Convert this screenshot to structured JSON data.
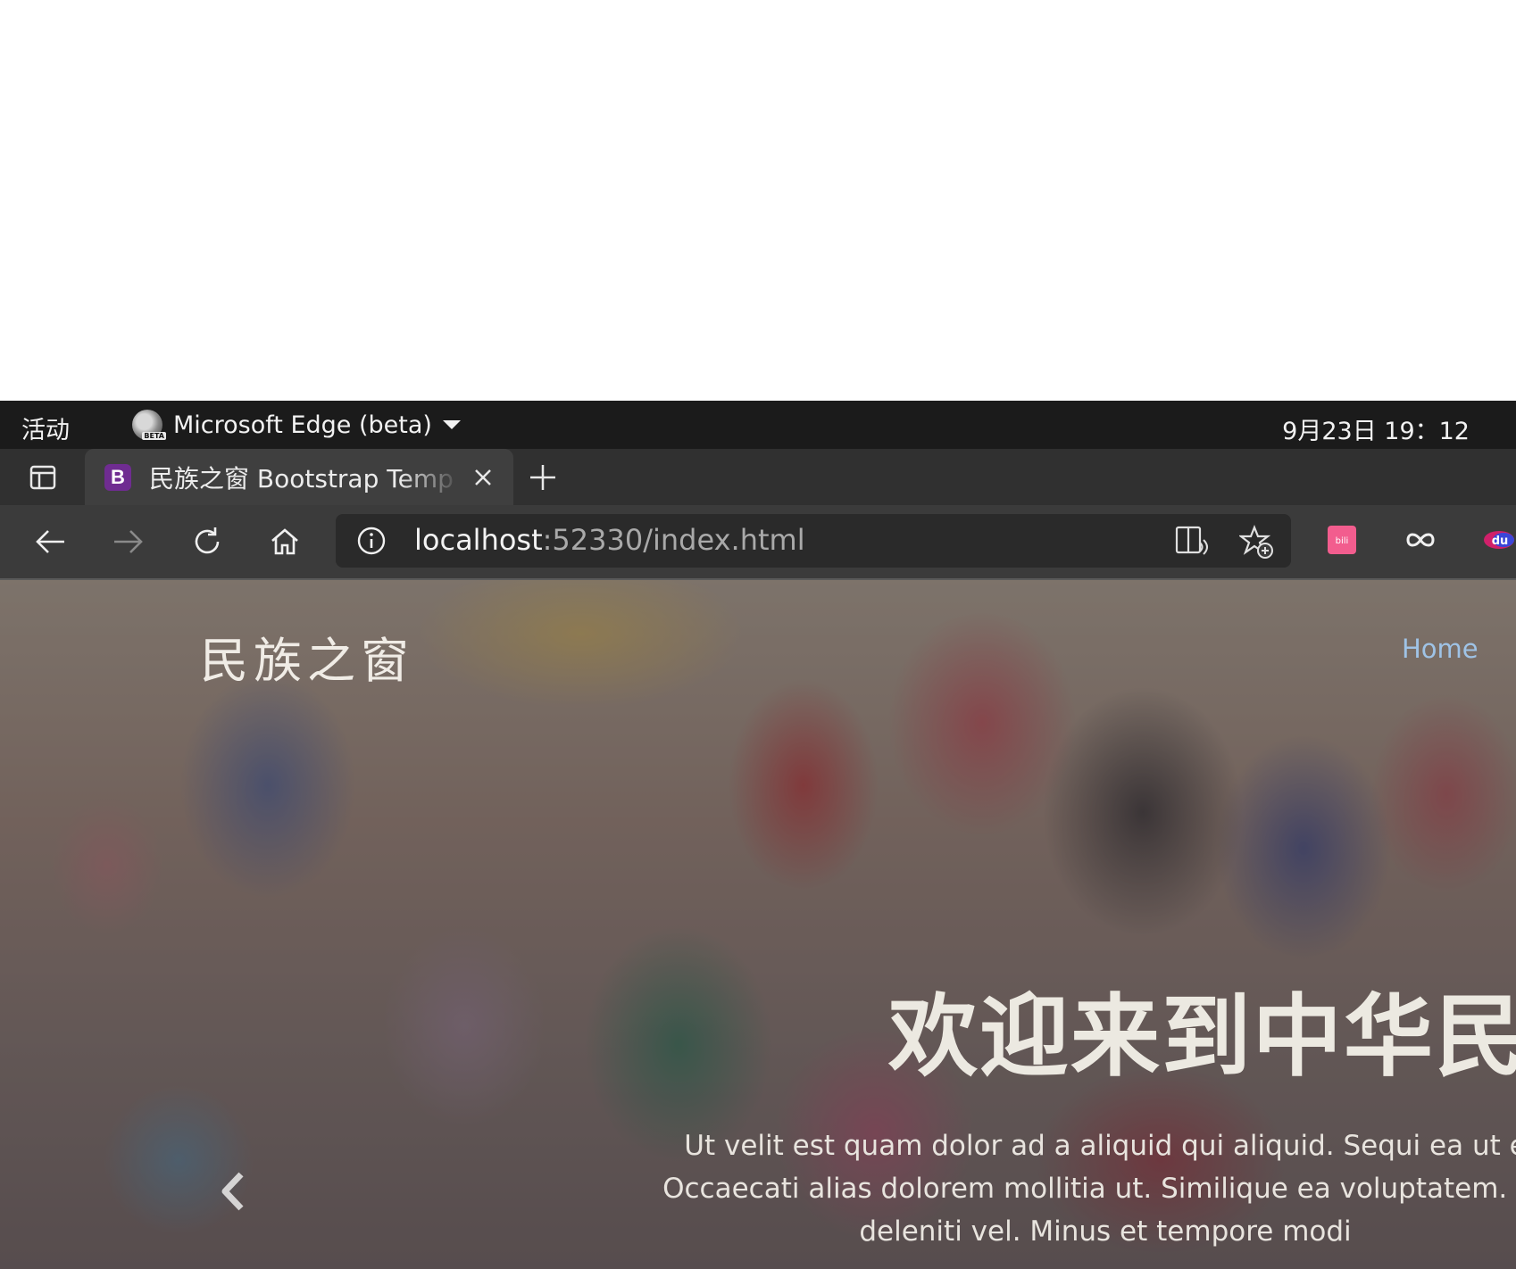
{
  "system_bar": {
    "activities": "活动",
    "app_name": "Microsoft Edge (beta)",
    "app_badge": "BETA",
    "clock": "9月23日  19：12"
  },
  "browser": {
    "tab": {
      "favicon_letter": "B",
      "title": "民族之窗 Bootstrap Temp"
    },
    "address": {
      "host": "localhost",
      "rest": ":52330/index.html"
    },
    "extensions": [
      "bilibili-icon",
      "infinity-icon",
      "du-icon"
    ],
    "colors": {
      "favicon": "#6f2c91",
      "bilibili": "#f25d8e"
    }
  },
  "page": {
    "brand": "民族之窗",
    "nav_home": "Home",
    "hero_title": "欢迎来到中华民族",
    "hero_lines": [
      "Ut velit est quam dolor ad a aliquid qui aliquid. Sequi ea ut e",
      "Occaecati alias dolorem mollitia ut. Similique ea voluptatem. Es",
      "deleniti vel. Minus et tempore modi"
    ]
  }
}
